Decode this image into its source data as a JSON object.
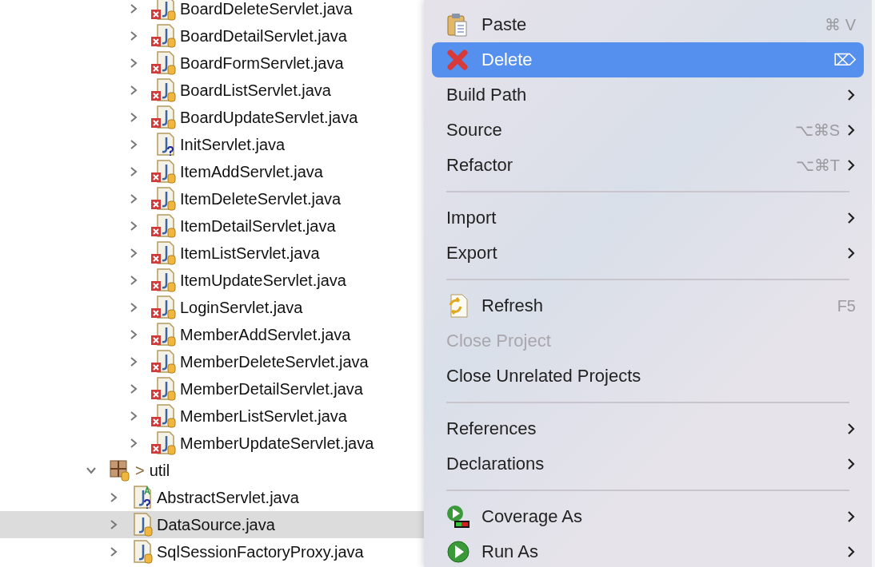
{
  "tree": {
    "files": [
      {
        "name": "BoardDeleteServlet.java",
        "kind": "error",
        "expanded": false,
        "selected": false
      },
      {
        "name": "BoardDetailServlet.java",
        "kind": "error",
        "expanded": false,
        "selected": false
      },
      {
        "name": "BoardFormServlet.java",
        "kind": "error",
        "expanded": false,
        "selected": false
      },
      {
        "name": "BoardListServlet.java",
        "kind": "error",
        "expanded": false,
        "selected": false
      },
      {
        "name": "BoardUpdateServlet.java",
        "kind": "error",
        "expanded": false,
        "selected": false
      },
      {
        "name": "InitServlet.java",
        "kind": "unknown",
        "expanded": false,
        "selected": false
      },
      {
        "name": "ItemAddServlet.java",
        "kind": "error",
        "expanded": false,
        "selected": false
      },
      {
        "name": "ItemDeleteServlet.java",
        "kind": "error",
        "expanded": false,
        "selected": false
      },
      {
        "name": "ItemDetailServlet.java",
        "kind": "error",
        "expanded": false,
        "selected": false
      },
      {
        "name": "ItemListServlet.java",
        "kind": "error",
        "expanded": false,
        "selected": false
      },
      {
        "name": "ItemUpdateServlet.java",
        "kind": "error",
        "expanded": false,
        "selected": false
      },
      {
        "name": "LoginServlet.java",
        "kind": "error",
        "expanded": false,
        "selected": false
      },
      {
        "name": "MemberAddServlet.java",
        "kind": "error",
        "expanded": false,
        "selected": false
      },
      {
        "name": "MemberDeleteServlet.java",
        "kind": "error",
        "expanded": false,
        "selected": false
      },
      {
        "name": "MemberDetailServlet.java",
        "kind": "error",
        "expanded": false,
        "selected": false
      },
      {
        "name": "MemberListServlet.java",
        "kind": "error",
        "expanded": false,
        "selected": false
      },
      {
        "name": "MemberUpdateServlet.java",
        "kind": "error",
        "expanded": false,
        "selected": false
      }
    ],
    "package": {
      "prefix": ">",
      "name": "util",
      "expanded": true,
      "selected": false,
      "children": [
        {
          "name": "AbstractServlet.java",
          "kind": "abstract",
          "expanded": false,
          "selected": false
        },
        {
          "name": "DataSource.java",
          "kind": "plain",
          "expanded": false,
          "selected": true
        },
        {
          "name": "SqlSessionFactoryProxy.java",
          "kind": "plain",
          "expanded": false,
          "selected": false
        }
      ]
    }
  },
  "context_menu": {
    "items": [
      {
        "kind": "paste",
        "label": "Paste",
        "shortcut": "⌘ V",
        "submenu": false,
        "disabled": false,
        "selected": false
      },
      {
        "kind": "delete",
        "label": "Delete",
        "shortcut": "⌦",
        "submenu": false,
        "disabled": false,
        "selected": true
      },
      {
        "kind": "item",
        "label": "Build Path",
        "submenu": true,
        "disabled": false,
        "selected": false
      },
      {
        "kind": "item",
        "label": "Source",
        "shortcut": "⌥⌘S",
        "submenu": true,
        "disabled": false,
        "selected": false
      },
      {
        "kind": "item",
        "label": "Refactor",
        "shortcut": "⌥⌘T",
        "submenu": true,
        "disabled": false,
        "selected": false
      },
      {
        "kind": "separator"
      },
      {
        "kind": "item",
        "label": "Import",
        "submenu": true,
        "disabled": false,
        "selected": false
      },
      {
        "kind": "item",
        "label": "Export",
        "submenu": true,
        "disabled": false,
        "selected": false
      },
      {
        "kind": "separator"
      },
      {
        "kind": "refresh",
        "label": "Refresh",
        "shortcut": "F5",
        "submenu": false,
        "disabled": false,
        "selected": false
      },
      {
        "kind": "item",
        "label": "Close Project",
        "submenu": false,
        "disabled": true,
        "selected": false
      },
      {
        "kind": "item",
        "label": "Close Unrelated Projects",
        "submenu": false,
        "disabled": false,
        "selected": false
      },
      {
        "kind": "separator"
      },
      {
        "kind": "item",
        "label": "References",
        "submenu": true,
        "disabled": false,
        "selected": false
      },
      {
        "kind": "item",
        "label": "Declarations",
        "submenu": true,
        "disabled": false,
        "selected": false
      },
      {
        "kind": "separator"
      },
      {
        "kind": "coverage",
        "label": "Coverage As",
        "submenu": true,
        "disabled": false,
        "selected": false
      },
      {
        "kind": "run",
        "label": "Run As",
        "submenu": true,
        "disabled": false,
        "selected": false
      }
    ]
  }
}
